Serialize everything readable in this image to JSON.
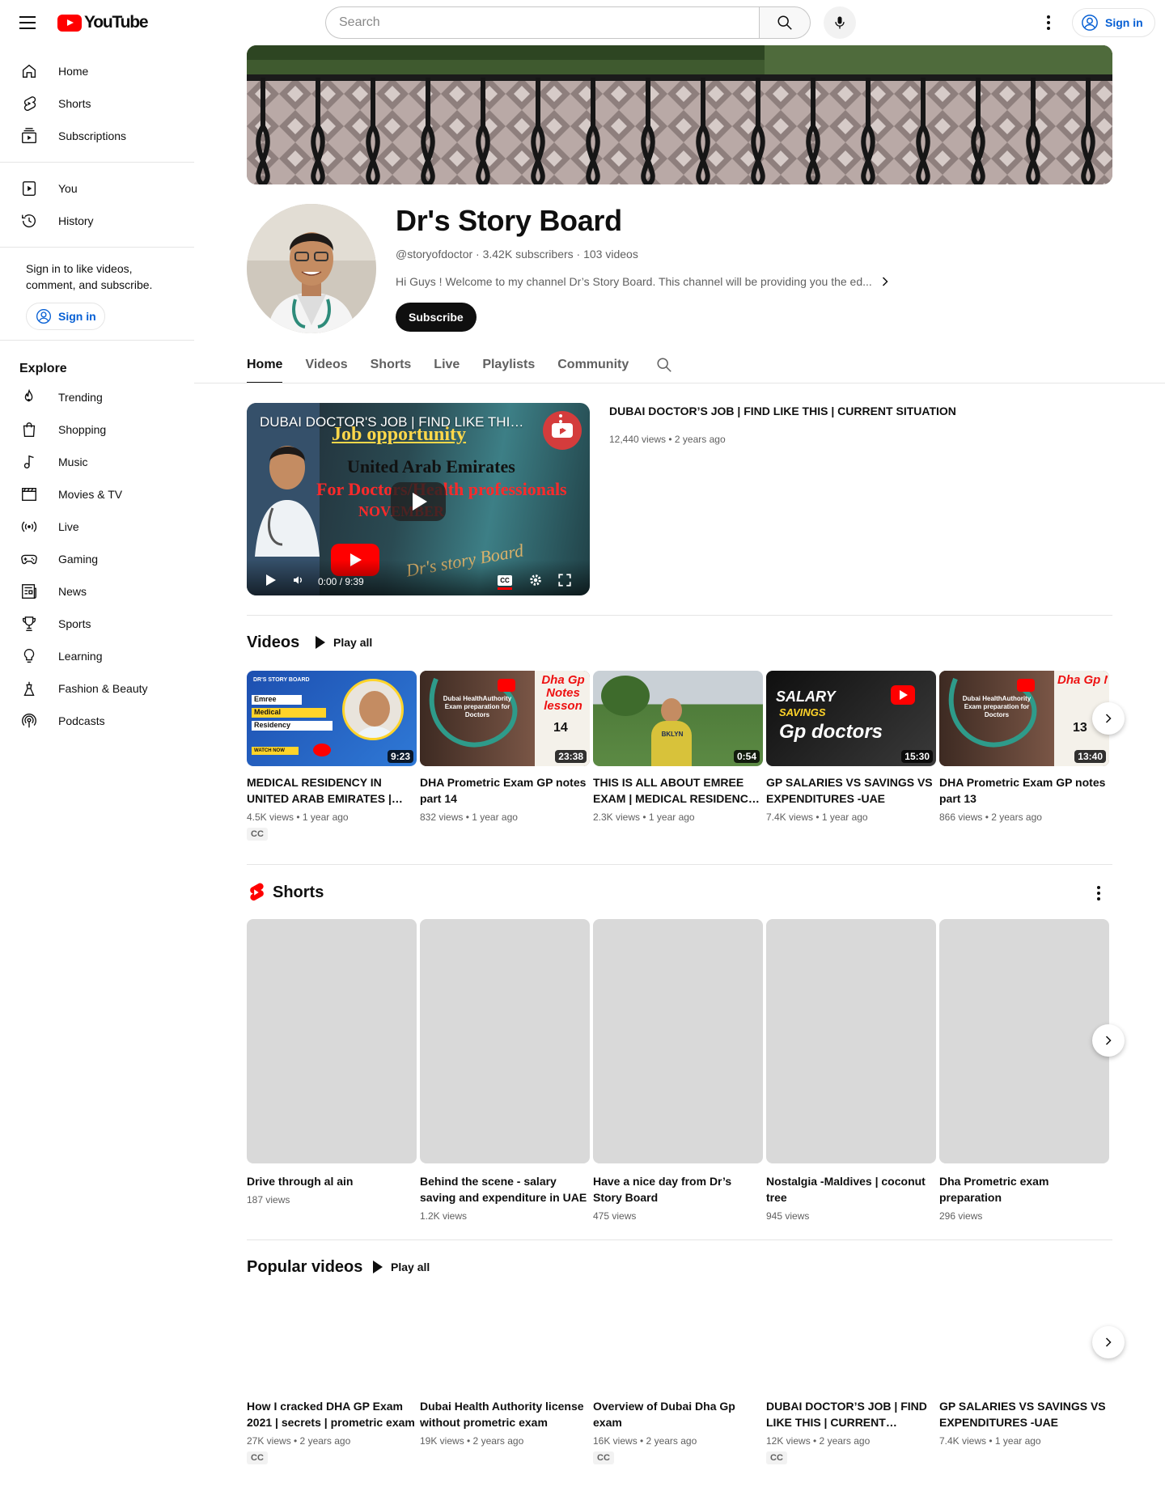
{
  "header": {
    "logo_text": "YouTube",
    "search_placeholder": "Search",
    "signin_label": "Sign in"
  },
  "sidebar": {
    "main_items": [
      {
        "label": "Home",
        "icon": "home-icon"
      },
      {
        "label": "Shorts",
        "icon": "shorts-icon"
      },
      {
        "label": "Subscriptions",
        "icon": "subscriptions-icon"
      }
    ],
    "you_items": [
      {
        "label": "You",
        "icon": "you-icon"
      },
      {
        "label": "History",
        "icon": "history-icon"
      }
    ],
    "signin_note": "Sign in to like videos, comment, and subscribe.",
    "signin_label": "Sign in",
    "explore_title": "Explore",
    "explore_items": [
      {
        "label": "Trending",
        "icon": "trending-icon"
      },
      {
        "label": "Shopping",
        "icon": "shopping-icon"
      },
      {
        "label": "Music",
        "icon": "music-icon"
      },
      {
        "label": "Movies & TV",
        "icon": "movies-icon"
      },
      {
        "label": "Live",
        "icon": "live-icon"
      },
      {
        "label": "Gaming",
        "icon": "gaming-icon"
      },
      {
        "label": "News",
        "icon": "news-icon"
      },
      {
        "label": "Sports",
        "icon": "sports-icon"
      },
      {
        "label": "Learning",
        "icon": "learning-icon"
      },
      {
        "label": "Fashion & Beauty",
        "icon": "fashion-icon"
      },
      {
        "label": "Podcasts",
        "icon": "podcasts-icon"
      }
    ]
  },
  "channel": {
    "name": "Dr's Story Board",
    "handle": "@storyofdoctor",
    "subscribers": "3.42K subscribers",
    "videos": "103 videos",
    "description": "Hi Guys ! Welcome to my channel Dr’s Story Board. This channel will be providing you the ed...",
    "subscribe_label": "Subscribe"
  },
  "tabs": [
    "Home",
    "Videos",
    "Shorts",
    "Live",
    "Playlists",
    "Community"
  ],
  "featured": {
    "overlay_title": "DUBAI DOCTOR'S JOB | FIND LIKE THIS | ...",
    "thumb_line1": "Job opportunity",
    "thumb_line2": "United Arab Emirates",
    "thumb_line3": "For Doctors/Health professionals",
    "thumb_line4": "NOVEMBER",
    "thumb_signature": "Dr's story Board",
    "time": "0:00 / 9:39",
    "title": "DUBAI DOCTOR’S JOB | FIND LIKE THIS | CURRENT SITUATION",
    "meta": "12,440 views • 2 years ago"
  },
  "videos_section": {
    "title": "Videos",
    "play_all": "Play all",
    "items": [
      {
        "title": "MEDICAL RESIDENCY IN UNITED ARAB EMIRATES | EMREE EXAM",
        "meta": "4.5K views • 1 year ago",
        "duration": "9:23",
        "cc": "CC",
        "thumb_text": "DR'S STORY BOARD",
        "thumb_lines": [
          "Emree",
          "Medical",
          "Residency"
        ],
        "thumb_watch": "WATCH NOW"
      },
      {
        "title": "DHA Prometric Exam GP notes part 14",
        "meta": "832 views • 1 year ago",
        "duration": "23:38",
        "thumb_lines": [
          "Dubai HealthAuthority Exam preparation for Doctors"
        ],
        "thumb_tag": "Dha Gp Notes lesson",
        "thumb_num": "14"
      },
      {
        "title": "THIS IS ALL ABOUT EMREE EXAM | MEDICAL RESIDENCY UAE",
        "meta": "2.3K views • 1 year ago",
        "duration": "0:54",
        "thumb_shirt": "BKLYN"
      },
      {
        "title": "GP SALARIES VS SAVINGS VS EXPENDITURES -UAE",
        "meta": "7.4K views • 1 year ago",
        "duration": "15:30",
        "thumb_lines": [
          "SALARY",
          "SAVINGS",
          "Gp doctors"
        ]
      },
      {
        "title": "DHA Prometric Exam GP notes part 13",
        "meta": "866 views • 2 years ago",
        "duration": "13:40",
        "thumb_lines": [
          "Dubai HealthAuthority Exam preparation for Doctors"
        ],
        "thumb_tag": "Dha Gp Notes lesso",
        "thumb_num": "13"
      }
    ]
  },
  "shorts_section": {
    "title": "Shorts",
    "items": [
      {
        "title": "Drive through al ain",
        "meta": "187 views"
      },
      {
        "title": "Behind the scene - salary saving and expenditure in UAE",
        "meta": "1.2K views"
      },
      {
        "title": "Have a nice day from Dr’s Story Board",
        "meta": "475 views"
      },
      {
        "title": "Nostalgia -Maldives | coconut tree",
        "meta": "945 views"
      },
      {
        "title": "Dha Prometric exam preparation",
        "meta": "296 views"
      }
    ]
  },
  "popular_section": {
    "title": "Popular videos",
    "play_all": "Play all",
    "items": [
      {
        "title": "How I cracked DHA GP Exam 2021 | secrets | prometric exam",
        "meta": "27K views • 2 years ago",
        "cc": "CC"
      },
      {
        "title": "Dubai Health Authority license without prometric exam",
        "meta": "19K views • 2 years ago",
        "cc": ""
      },
      {
        "title": "Overview of Dubai Dha Gp exam",
        "meta": "16K views • 2 years ago",
        "cc": "CC"
      },
      {
        "title": "DUBAI DOCTOR’S JOB | FIND LIKE THIS | CURRENT SITUATION",
        "meta": "12K views • 2 years ago",
        "cc": "CC"
      },
      {
        "title": "GP SALARIES VS SAVINGS VS EXPENDITURES -UAE",
        "meta": "7.4K views • 1 year ago",
        "cc": ""
      }
    ]
  },
  "colors": {
    "brand_red": "#ff0000",
    "link_blue": "#065fd4",
    "text_secondary": "#606060"
  }
}
